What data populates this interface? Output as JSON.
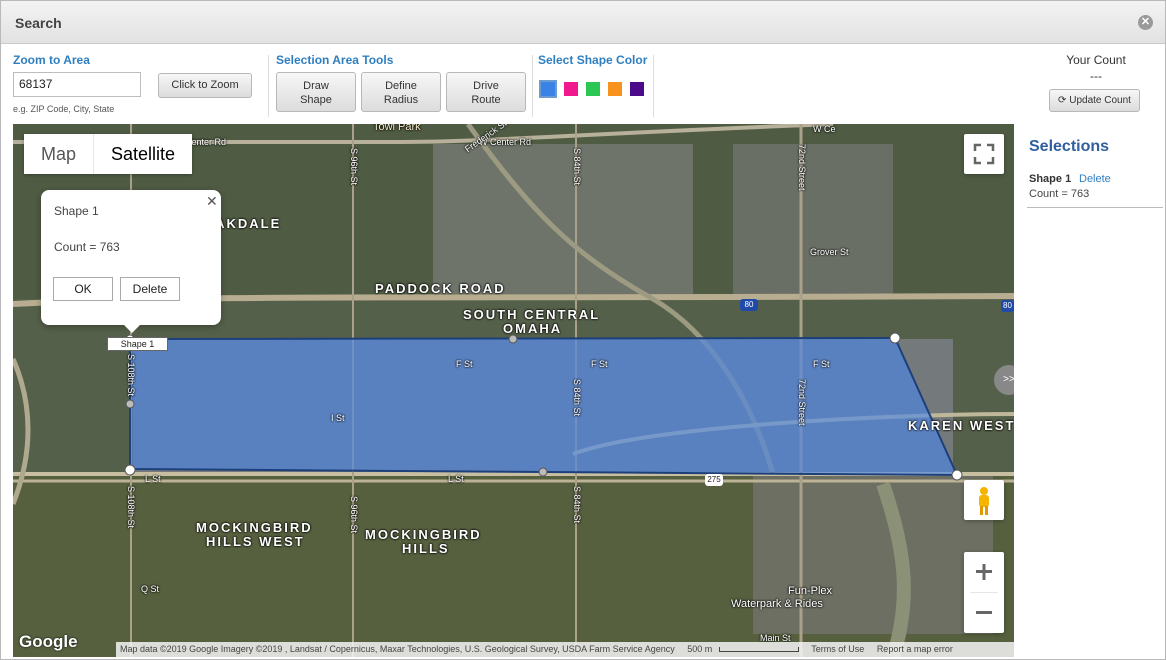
{
  "window": {
    "title": "Search",
    "close_glyph": "✕"
  },
  "zoom": {
    "section_title": "Zoom to Area",
    "input_value": "68137",
    "hint": "e.g. ZIP Code, City, State",
    "button": "Click to Zoom"
  },
  "tools": {
    "section_title": "Selection Area Tools",
    "draw_shape": [
      "Draw",
      "Shape"
    ],
    "define_radius": [
      "Define",
      "Radius"
    ],
    "drive_route": [
      "Drive",
      "Route"
    ]
  },
  "colors": {
    "section_title": "Select Shape Color",
    "swatches": [
      "#3b82e6",
      "#f0188c",
      "#2bc653",
      "#f7921e",
      "#4b0a8a"
    ],
    "selected": "#3b82e6"
  },
  "count": {
    "label": "Your Count",
    "value": "---",
    "button": "Update Count"
  },
  "map": {
    "type_map": "Map",
    "type_satellite": "Satellite",
    "popup": {
      "title": "Shape 1",
      "count": "Count = 763",
      "ok": "OK",
      "delete": "Delete",
      "close": "✕"
    },
    "shape_tag": "Shape 1",
    "side_toggle": ">>",
    "google": "Google",
    "attribution": "Map data ©2019 Google Imagery ©2019 , Landsat / Copernicus, Maxar Technologies, U.S. Geological Survey, USDA Farm Service Agency",
    "scale": "500 m",
    "terms": "Terms of Use",
    "report": "Report a map error",
    "shape_fill": "#4a86e8",
    "labels": {
      "oakdale": "OAKDALE",
      "paddock": "PADDOCK ROAD",
      "south_central": "SOUTH CENTRAL",
      "omaha": "OMAHA",
      "karen": "KAREN WEST",
      "mock_hw1": "MOCKINGBIRD",
      "mock_hw2": "HILLS WEST",
      "mock_h1": "MOCKINGBIRD",
      "mock_h2": "HILLS",
      "center_rd": "Center Rd",
      "w_center_rd": "W Center Rd",
      "frederick": "Frederick St",
      "s96": "S 96th St",
      "s84": "S 84th St",
      "s72": "72nd Street",
      "s108": "S 108th St",
      "grover": "Grover St",
      "fst1": "F St",
      "fst2": "F St",
      "fst3": "F St",
      "ist": "I St",
      "lst1": "L St",
      "lst2": "L St",
      "qst": "Q St",
      "funplex": "Fun-Plex",
      "waterpark": "Waterpark & Rides",
      "main": "Main St",
      "wcenter2": "W Ce",
      "towl": "Towl Park",
      "i80": "80",
      "i680": "80",
      "us275": "275"
    }
  },
  "selections": {
    "title": "Selections",
    "items": [
      {
        "name": "Shape 1",
        "delete": "Delete",
        "count": "Count = 763"
      }
    ]
  }
}
